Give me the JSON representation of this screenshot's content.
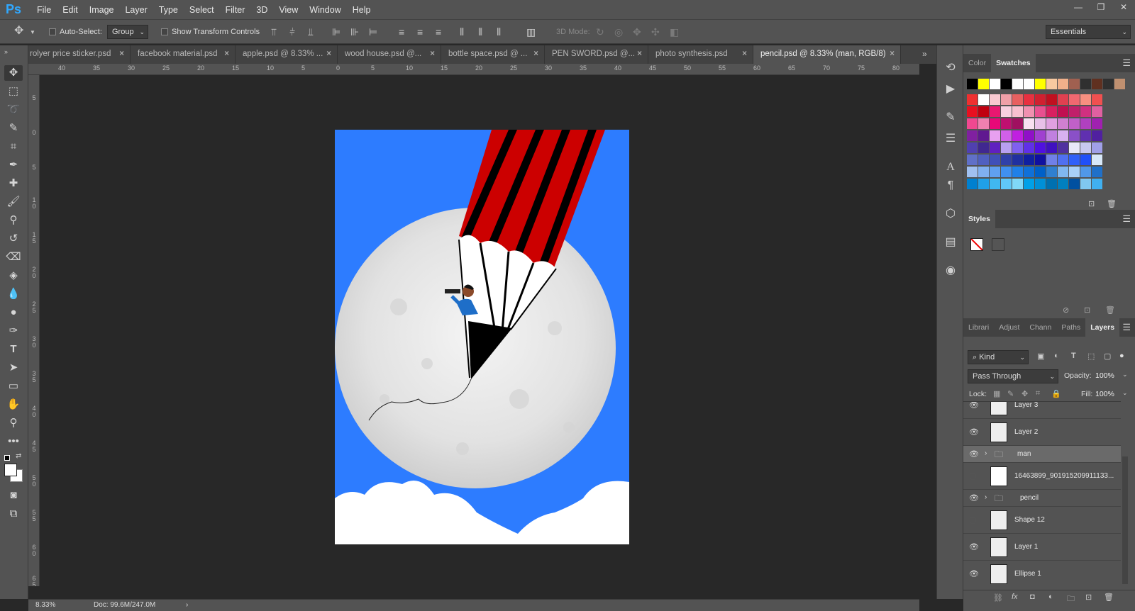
{
  "app": {
    "logo": "Ps"
  },
  "menu": [
    "File",
    "Edit",
    "Image",
    "Layer",
    "Type",
    "Select",
    "Filter",
    "3D",
    "View",
    "Window",
    "Help"
  ],
  "window_controls": {
    "minimize": "—",
    "restore": "❐",
    "close": "✕"
  },
  "options": {
    "auto_select_label": "Auto-Select:",
    "auto_select_value": "Group",
    "show_transform_label": "Show Transform Controls",
    "mode_3d_label": "3D Mode:",
    "workspace": "Essentials"
  },
  "tabs": [
    {
      "label": "rolyer price sticker.psd",
      "active": false
    },
    {
      "label": "facebook material.psd",
      "active": false
    },
    {
      "label": "apple.psd @ 8.33% ...",
      "active": false
    },
    {
      "label": "wood house.psd @...",
      "active": false
    },
    {
      "label": "bottle space.psd @ ...",
      "active": false
    },
    {
      "label": "PEN SWORD.psd @...",
      "active": false
    },
    {
      "label": "photo synthesis.psd",
      "active": false
    },
    {
      "label": "pencil.psd @ 8.33% (man, RGB/8)",
      "active": true
    }
  ],
  "ruler_top": [
    "40",
    "35",
    "30",
    "25",
    "20",
    "15",
    "10",
    "5",
    "0",
    "5",
    "10",
    "15",
    "20",
    "25",
    "30",
    "35",
    "40",
    "45",
    "50",
    "55",
    "60",
    "65",
    "70",
    "75",
    "80"
  ],
  "ruler_left": [
    "5",
    "0",
    "5",
    "1 0",
    "1 5",
    "2 0",
    "2 5",
    "3 0",
    "3 5",
    "4 0",
    "4 5",
    "5 0",
    "5 5",
    "6 0",
    "6 5"
  ],
  "status": {
    "zoom": "8.33%",
    "doc": "Doc: 99.6M/247.0M"
  },
  "panels": {
    "color_tab": "Color",
    "swatches_tab": "Swatches",
    "styles_tab": "Styles",
    "layer_tabs": [
      "Librari",
      "Adjust",
      "Chann",
      "Paths",
      "Layers"
    ],
    "kind_label": "Kind",
    "blend_mode": "Pass Through",
    "opacity_label": "Opacity:",
    "opacity_value": "100%",
    "lock_label": "Lock:",
    "fill_label": "Fill:",
    "fill_value": "100%"
  },
  "swatch_top_row": [
    "#000000",
    "#ffff00",
    "#ffffff",
    "#000000",
    "#ffffff",
    "#ffffff",
    "#ffff00",
    "#f7c9a0",
    "#f0b08a",
    "#a06050",
    "#303030",
    "#603020",
    "#303030",
    "#c09070"
  ],
  "swatch_grid": [
    [
      "#f03030",
      "#ffffff",
      "#f8c8d0",
      "#f0a0a8",
      "#e86060",
      "#e83040",
      "#d02030",
      "#c01020",
      "#e04050",
      "#f06870",
      "#f89080",
      "#f05050"
    ],
    [
      "#e81020",
      "#c00010",
      "#e81870",
      "#f8d0e0",
      "#f8c0d0",
      "#f090b0",
      "#e85090",
      "#d82060",
      "#c01050",
      "#c0206a",
      "#d03080",
      "#e060a0"
    ],
    [
      "#f04890",
      "#f080b0",
      "#e80878",
      "#c01070",
      "#a01060",
      "#f8e0f0",
      "#e8c0e8",
      "#e0a0e0",
      "#d080d0",
      "#c060c8",
      "#b040c0",
      "#a020b0"
    ],
    [
      "#8020a0",
      "#601890",
      "#e8a0f0",
      "#d060e8",
      "#c020e0",
      "#9010c8",
      "#a040d0",
      "#c080e0",
      "#d8b0f0",
      "#8a50c8",
      "#6030b0",
      "#5020a0"
    ],
    [
      "#5040b0",
      "#402890",
      "#6020c0",
      "#b8a0f0",
      "#8060f0",
      "#6030e8",
      "#5010e0",
      "#4010c0",
      "#5030a0",
      "#e8e8f8",
      "#c8c8f0",
      "#a0a0e8"
    ],
    [
      "#6070c8",
      "#5060c0",
      "#4050b8",
      "#3040a8",
      "#2030a0",
      "#1020a0",
      "#1010a0",
      "#7080e8",
      "#5070f0",
      "#3060f8",
      "#2050f8",
      "#d8e8f8"
    ],
    [
      "#a0c0f0",
      "#80b0f0",
      "#60a0f0",
      "#4090f0",
      "#2080e8",
      "#1070d8",
      "#0060c8",
      "#3080d0",
      "#80b8f0",
      "#a8d0f8",
      "#5098e8",
      "#2070c8"
    ],
    [
      "#0080d0",
      "#20a0e8",
      "#40b8f0",
      "#60c8f8",
      "#80d8f8",
      "#00a0e8",
      "#0090d8",
      "#0070b0",
      "#0080c0",
      "#0050a0",
      "#80c8f0",
      "#40b0f0"
    ]
  ],
  "layers": [
    {
      "name": "Layer 3",
      "visible": true,
      "type": "layer"
    },
    {
      "name": "Layer 2",
      "visible": true,
      "type": "layer"
    },
    {
      "name": "man",
      "visible": true,
      "type": "group"
    },
    {
      "name": "16463899_901915209911133...",
      "visible": false,
      "type": "layer"
    },
    {
      "name": "pencil",
      "visible": true,
      "type": "group"
    },
    {
      "name": "Shape 12",
      "visible": false,
      "type": "layer"
    },
    {
      "name": "Layer 1",
      "visible": true,
      "type": "layer"
    },
    {
      "name": "Ellipse 1",
      "visible": true,
      "type": "layer"
    }
  ],
  "colors": {
    "accent": "#31a8ff",
    "canvas_bg": "#2d7cff"
  }
}
